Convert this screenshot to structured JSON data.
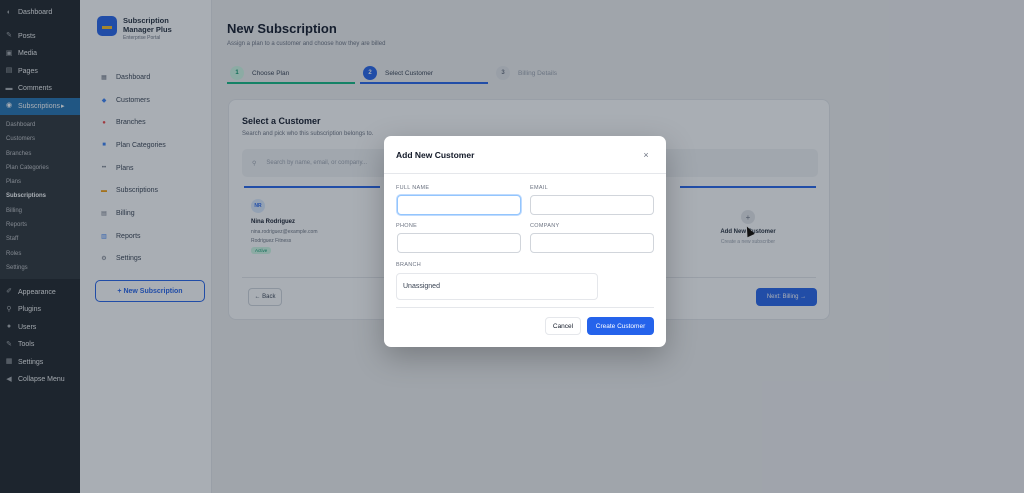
{
  "wp_menu": {
    "top": [
      {
        "label": "Dashboard",
        "icon": "dashboard-icon"
      }
    ],
    "items": [
      {
        "label": "Posts",
        "icon": "pin-icon"
      },
      {
        "label": "Media",
        "icon": "media-icon"
      },
      {
        "label": "Pages",
        "icon": "pages-icon"
      },
      {
        "label": "Comments",
        "icon": "comment-icon"
      },
      {
        "label": "Subscriptions",
        "icon": "subscriptions-icon"
      }
    ],
    "submenu": [
      "Dashboard",
      "Customers",
      "Branches",
      "Plan Categories",
      "Plans",
      "Subscriptions",
      "Billing",
      "Reports",
      "Staff",
      "Roles",
      "Settings"
    ],
    "bottom": [
      {
        "label": "Appearance",
        "icon": "brush-icon"
      },
      {
        "label": "Plugins",
        "icon": "plugin-icon"
      },
      {
        "label": "Users",
        "icon": "users-icon"
      },
      {
        "label": "Tools",
        "icon": "tools-icon"
      },
      {
        "label": "Settings",
        "icon": "settings-icon"
      },
      {
        "label": "Collapse Menu",
        "icon": "collapse-icon"
      }
    ]
  },
  "plugin": {
    "title": "Subscription Manager Plus",
    "subtitle": "Enterprise Portal",
    "nav": [
      {
        "label": "Dashboard",
        "icon": "grid-icon"
      },
      {
        "label": "Customers",
        "icon": "user-icon"
      },
      {
        "label": "Branches",
        "icon": "location-icon"
      },
      {
        "label": "Plan Categories",
        "icon": "folder-icon"
      },
      {
        "label": "Plans",
        "icon": "list-icon"
      },
      {
        "label": "Subscriptions",
        "icon": "card-icon"
      },
      {
        "label": "Billing",
        "icon": "billing-icon"
      },
      {
        "label": "Reports",
        "icon": "chart-icon"
      },
      {
        "label": "Settings",
        "icon": "gear-icon"
      }
    ],
    "new_button": "+ New Subscription"
  },
  "page": {
    "title": "New Subscription",
    "subtitle": "Assign a plan to a customer and choose how they are billed",
    "steps": [
      {
        "num": "1",
        "label": "Choose Plan",
        "state": "done"
      },
      {
        "num": "2",
        "label": "Select Customer",
        "state": "active"
      },
      {
        "num": "3",
        "label": "Billing Details",
        "state": "pending"
      }
    ]
  },
  "card": {
    "title": "Select a Customer",
    "subtitle": "Search and pick who this subscription belongs to.",
    "search_placeholder": "Search by name, email, or company...",
    "customer": {
      "initials": "NR",
      "name": "Nina Rodriguez",
      "email": "nina.rodriguez@example.com",
      "company": "Rodriguez Fitness",
      "badge": "Active"
    },
    "add_card": {
      "title": "Add New Customer",
      "subtitle": "Create a new subscriber"
    },
    "back_label": "← Back",
    "next_label": "Next: Billing →"
  },
  "modal": {
    "title": "Add New Customer",
    "close": "×",
    "fields": {
      "full_name": {
        "label": "FULL NAME",
        "value": ""
      },
      "email": {
        "label": "EMAIL",
        "value": ""
      },
      "phone": {
        "label": "PHONE",
        "value": ""
      },
      "company": {
        "label": "COMPANY",
        "value": ""
      }
    },
    "branch": {
      "label": "BRANCH",
      "value": "Unassigned"
    },
    "cancel": "Cancel",
    "create": "Create Customer"
  },
  "colors": {
    "accent": "#2563eb",
    "wp_sidebar": "#1d2327",
    "wp_active": "#2271b1",
    "success": "#10b981"
  }
}
